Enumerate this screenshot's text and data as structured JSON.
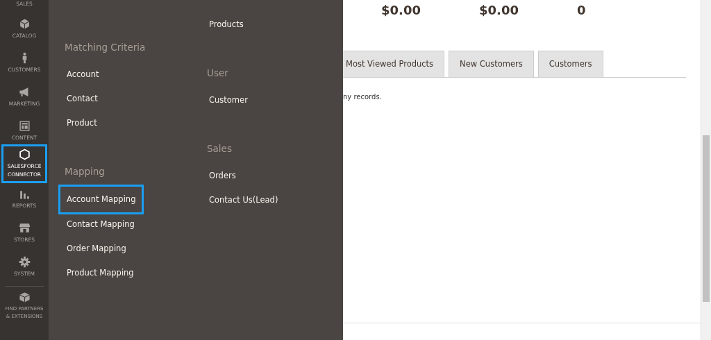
{
  "sidebar": {
    "items": [
      {
        "label": "SALES",
        "selected": false
      },
      {
        "label": "CATALOG",
        "selected": false
      },
      {
        "label": "CUSTOMERS",
        "selected": false
      },
      {
        "label": "MARKETING",
        "selected": false
      },
      {
        "label": "CONTENT",
        "selected": false
      },
      {
        "label": "SALESFORCE CONNECTOR",
        "selected": true
      },
      {
        "label": "REPORTS",
        "selected": false
      },
      {
        "label": "STORES",
        "selected": false
      },
      {
        "label": "SYSTEM",
        "selected": false
      },
      {
        "label": "FIND PARTNERS & EXTENSIONS",
        "selected": false
      }
    ]
  },
  "flyout": {
    "columns": [
      {
        "sections": [
          {
            "heading": "Matching Criteria",
            "items": [
              {
                "label": "Account",
                "selected": false
              },
              {
                "label": "Contact",
                "selected": false
              },
              {
                "label": "Product",
                "selected": false
              }
            ]
          },
          {
            "heading": "Mapping",
            "items": [
              {
                "label": "Account Mapping",
                "selected": true
              },
              {
                "label": "Contact Mapping",
                "selected": false
              },
              {
                "label": "Order Mapping",
                "selected": false
              },
              {
                "label": "Product Mapping",
                "selected": false
              }
            ]
          }
        ]
      },
      {
        "sections": [
          {
            "items": [
              {
                "label": "Products",
                "selected": false
              }
            ]
          },
          {
            "heading": "User",
            "items": [
              {
                "label": "Customer",
                "selected": false
              }
            ]
          },
          {
            "heading": "Sales",
            "items": [
              {
                "label": "Orders",
                "selected": false
              },
              {
                "label": "Contact Us(Lead)",
                "selected": false
              }
            ]
          }
        ]
      }
    ]
  },
  "stats": [
    "$0.00",
    "$0.00",
    "0"
  ],
  "tabs": [
    {
      "label": "Most Viewed Products"
    },
    {
      "label": "New Customers"
    },
    {
      "label": "Customers"
    }
  ],
  "tab_content": "ny records."
}
